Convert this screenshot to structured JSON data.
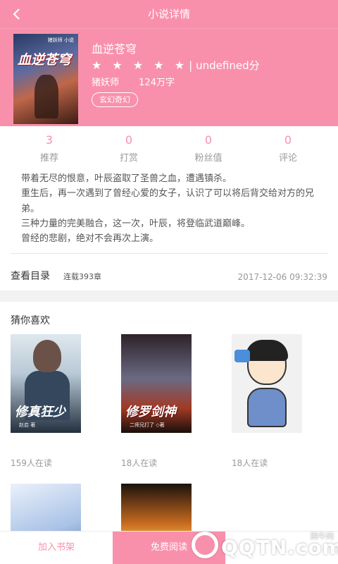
{
  "header": {
    "title": "小说详情",
    "back_icon": "chevron-left-icon"
  },
  "book": {
    "title": "血逆苍穹",
    "cover_title": "血逆苍穹",
    "cover_subtitle": "猪妖师 小说",
    "stars": "★ ★ ★ ★ ★",
    "rating_sep": "|",
    "rating_text": "undefined分",
    "author": "猪妖师",
    "word_count": "124万字",
    "genre": "玄幻奇幻"
  },
  "stats": [
    {
      "value": "3",
      "label": "推荐"
    },
    {
      "value": "0",
      "label": "打赏"
    },
    {
      "value": "0",
      "label": "粉丝值"
    },
    {
      "value": "0",
      "label": "评论"
    }
  ],
  "synopsis": {
    "lines": [
      "带着无尽的恨意，叶辰盗取了圣兽之血，遭遇镇杀。",
      "重生后，再一次遇到了曾经心爱的女子，认识了可以将后背交给对方的兄弟。",
      "三种力量的完美融合，这一次，叶辰，将登临武道巅峰。",
      "曾经的悲剧，绝对不会再次上演。"
    ]
  },
  "catalog": {
    "label": "查看目录",
    "chapters": "连载393章",
    "updated": "2017-12-06 09:32:39"
  },
  "recommend": {
    "title": "猜你喜欢",
    "books": [
      {
        "cover_text": "修真狂少",
        "cover_sub": "赵启 著",
        "reads": "159人在读"
      },
      {
        "cover_text": "修罗剑神",
        "cover_sub": "二师兄打了 ◇著",
        "reads": "18人在读"
      },
      {
        "cover_text": "",
        "cover_sub": "",
        "reads": "18人在读"
      },
      {
        "cover_text": "",
        "cover_sub": "",
        "reads": ""
      },
      {
        "cover_text": "",
        "cover_sub": "",
        "reads": ""
      }
    ]
  },
  "bottom": {
    "add_shelf": "加入书架",
    "free_read": "免费阅读",
    "download": ""
  },
  "watermark": {
    "brand": "QQTN.com",
    "cn": "腾牛网"
  },
  "colors": {
    "accent": "#f990ab",
    "text": "#555555",
    "muted": "#999999"
  }
}
